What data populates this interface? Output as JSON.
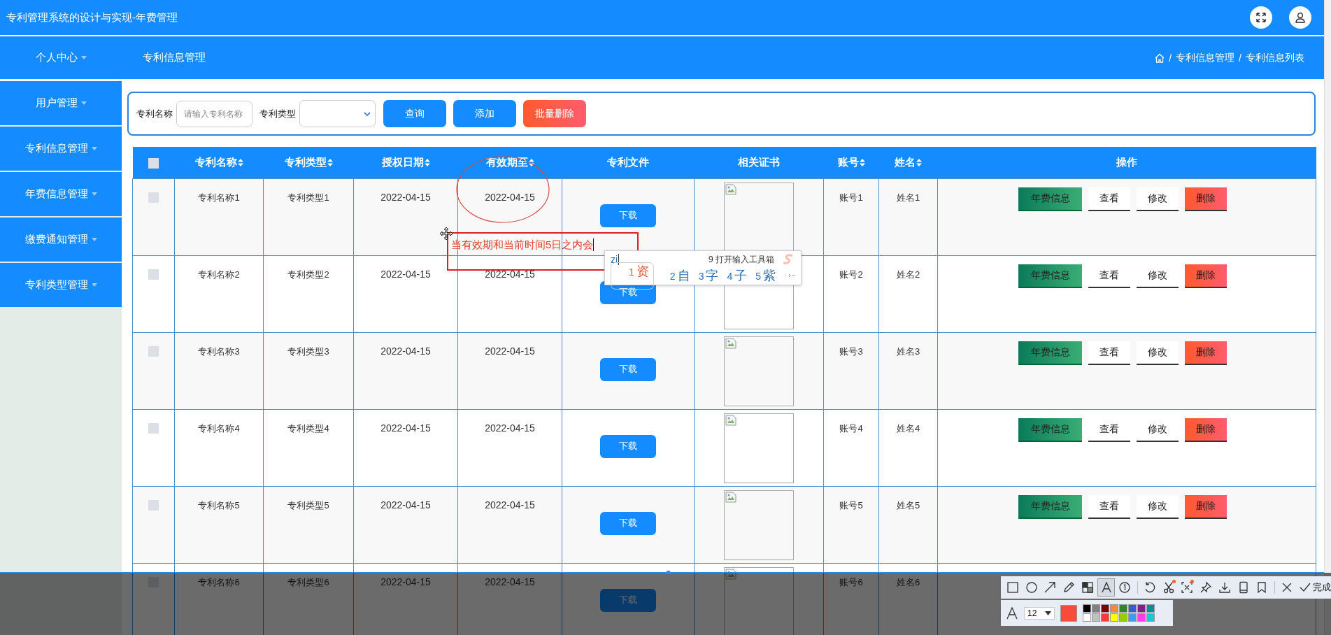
{
  "top_bar": {
    "title": "专利管理系统的设计与实现-年费管理"
  },
  "nav_bar": {
    "page_title": "专利信息管理",
    "breadcrumb": [
      {
        "separator": "/",
        "label": "专利信息管理"
      },
      {
        "separator": "/",
        "label": "专利信息列表"
      }
    ]
  },
  "sidebar": {
    "items": [
      {
        "label": "个人中心"
      },
      {
        "label": "用户管理"
      },
      {
        "label": "专利信息管理"
      },
      {
        "label": "年费信息管理"
      },
      {
        "label": "缴费通知管理"
      },
      {
        "label": "专利类型管理"
      }
    ]
  },
  "search": {
    "name_label": "专利名称",
    "name_placeholder": "请输入专利名称",
    "type_label": "专利类型",
    "buttons": [
      {
        "label": "查询",
        "kind": "primary"
      },
      {
        "label": "添加",
        "kind": "primary"
      },
      {
        "label": "批量删除",
        "kind": "danger"
      }
    ]
  },
  "table": {
    "columns": [
      {
        "kind": "checkbox",
        "checked": false
      },
      {
        "kind": "text",
        "label": "专利名称",
        "sortable": true
      },
      {
        "kind": "text",
        "label": "专利类型",
        "sortable": true
      },
      {
        "kind": "text",
        "label": "授权日期",
        "sortable": true
      },
      {
        "kind": "text",
        "label": "有效期至",
        "sortable": true
      },
      {
        "kind": "text",
        "label": "专利文件",
        "sortable": false
      },
      {
        "kind": "text",
        "label": "相关证书",
        "sortable": false
      },
      {
        "kind": "text",
        "label": "账号",
        "sortable": true
      },
      {
        "kind": "text",
        "label": "姓名",
        "sortable": true
      },
      {
        "kind": "text",
        "label": "操作",
        "sortable": false
      }
    ],
    "rows": [
      {
        "checked": false,
        "name": "专利名称1",
        "type": "专利类型1",
        "grant_date": "2022-04-15",
        "expiry_date": "2022-04-15",
        "file_button": "下载",
        "account": "账号1",
        "person": "姓名1",
        "actions": [
          {
            "label": "年费信息",
            "kind": "success"
          },
          {
            "label": "查看",
            "kind": "plain"
          },
          {
            "label": "修改",
            "kind": "plain"
          },
          {
            "label": "删除",
            "kind": "danger"
          }
        ]
      },
      {
        "checked": false,
        "name": "专利名称2",
        "type": "专利类型2",
        "grant_date": "2022-04-15",
        "expiry_date": "2022-04-15",
        "file_button": "下载",
        "account": "账号2",
        "person": "姓名2",
        "actions": [
          {
            "label": "年费信息",
            "kind": "success"
          },
          {
            "label": "查看",
            "kind": "plain"
          },
          {
            "label": "修改",
            "kind": "plain"
          },
          {
            "label": "删除",
            "kind": "danger"
          }
        ]
      },
      {
        "checked": false,
        "name": "专利名称3",
        "type": "专利类型3",
        "grant_date": "2022-04-15",
        "expiry_date": "2022-04-15",
        "file_button": "下载",
        "account": "账号3",
        "person": "姓名3",
        "actions": [
          {
            "label": "年费信息",
            "kind": "success"
          },
          {
            "label": "查看",
            "kind": "plain"
          },
          {
            "label": "修改",
            "kind": "plain"
          },
          {
            "label": "删除",
            "kind": "danger"
          }
        ]
      },
      {
        "checked": false,
        "name": "专利名称4",
        "type": "专利类型4",
        "grant_date": "2022-04-15",
        "expiry_date": "2022-04-15",
        "file_button": "下载",
        "account": "账号4",
        "person": "姓名4",
        "actions": [
          {
            "label": "年费信息",
            "kind": "success"
          },
          {
            "label": "查看",
            "kind": "plain"
          },
          {
            "label": "修改",
            "kind": "plain"
          },
          {
            "label": "删除",
            "kind": "danger"
          }
        ]
      },
      {
        "checked": false,
        "name": "专利名称5",
        "type": "专利类型5",
        "grant_date": "2022-04-15",
        "expiry_date": "2022-04-15",
        "file_button": "下载",
        "account": "账号5",
        "person": "姓名5",
        "actions": [
          {
            "label": "年费信息",
            "kind": "success"
          },
          {
            "label": "查看",
            "kind": "plain"
          },
          {
            "label": "修改",
            "kind": "plain"
          },
          {
            "label": "删除",
            "kind": "danger"
          }
        ]
      },
      {
        "checked": false,
        "name": "专利名称6",
        "type": "专利类型6",
        "grant_date": "2022-04-15",
        "expiry_date": "2022-04-15",
        "file_button": "下载",
        "account": "账号6",
        "person": "姓名6",
        "actions": []
      }
    ]
  },
  "annotations": [
    {
      "kind": "ellipse"
    },
    {
      "kind": "text_box",
      "text": "当有效期和当前时间5日之内会"
    }
  ],
  "ime": {
    "composition": "zi",
    "hint": "9 打开输入工具箱",
    "candidates": [
      {
        "number": "1",
        "text": "资",
        "selected": true
      },
      {
        "number": "2",
        "text": "自",
        "selected": false
      },
      {
        "number": "3",
        "text": "字",
        "selected": false
      },
      {
        "number": "4",
        "text": "子",
        "selected": false
      },
      {
        "number": "5",
        "text": "紫",
        "selected": false
      }
    ]
  },
  "capture_toolbar": {
    "tools": [
      {
        "kind": "rectangle",
        "selected": false
      },
      {
        "kind": "ellipse",
        "selected": false
      },
      {
        "kind": "arrow",
        "selected": false
      },
      {
        "kind": "pencil",
        "selected": false
      },
      {
        "kind": "mosaic",
        "selected": false
      },
      {
        "kind": "text",
        "selected": true
      },
      {
        "kind": "number",
        "selected": false
      },
      {
        "kind": "undo",
        "selected": false
      },
      {
        "kind": "scissors",
        "selected": false,
        "dot": true
      },
      {
        "kind": "ocr",
        "selected": false,
        "dot": true
      },
      {
        "kind": "pin",
        "selected": false
      },
      {
        "kind": "save",
        "selected": false
      },
      {
        "kind": "phone",
        "selected": false
      },
      {
        "kind": "bookmark",
        "selected": false
      },
      {
        "kind": "close",
        "selected": false
      }
    ],
    "done_label": "完成",
    "font_size": "12",
    "current": {
      "color": "#fa4a3a"
    },
    "palette": [
      {
        "color": "#000000"
      },
      {
        "color": "#808080"
      },
      {
        "color": "#800000"
      },
      {
        "color": "#f7883a"
      },
      {
        "color": "#308430"
      },
      {
        "color": "#385ad3"
      },
      {
        "color": "#851e8c"
      },
      {
        "color": "#009196"
      },
      {
        "color": "#ffffff"
      },
      {
        "color": "#c0c0c0"
      },
      {
        "color": "#fb3838"
      },
      {
        "color": "#ffff00"
      },
      {
        "color": "#99cc00"
      },
      {
        "color": "#3d9cf0"
      },
      {
        "color": "#f93cf0"
      },
      {
        "color": "#17c8dc"
      }
    ]
  }
}
